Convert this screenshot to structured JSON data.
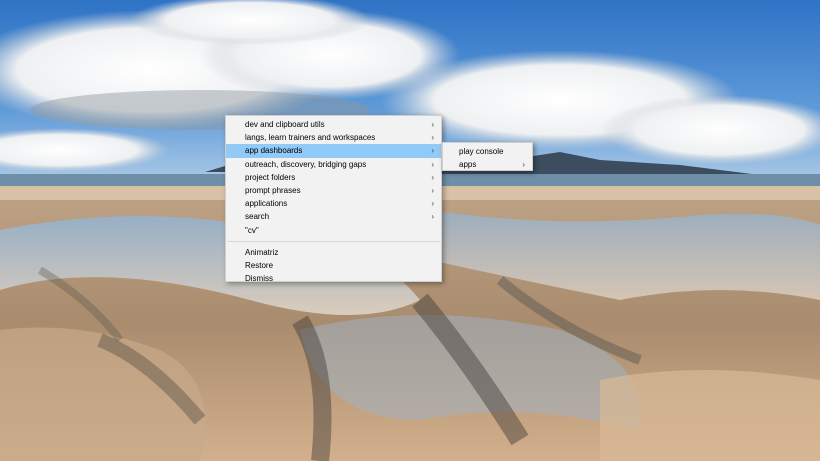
{
  "main_menu": {
    "items": [
      {
        "label": "dev and clipboard utils",
        "has_submenu": true
      },
      {
        "label": "langs, learn trainers and workspaces",
        "has_submenu": true
      },
      {
        "label": "app dashboards",
        "has_submenu": true,
        "highlighted": true
      },
      {
        "label": "outreach, discovery, bridging gaps",
        "has_submenu": true
      },
      {
        "label": "project folders",
        "has_submenu": true
      },
      {
        "label": "prompt phrases",
        "has_submenu": true
      },
      {
        "label": "applications",
        "has_submenu": true
      },
      {
        "label": "search",
        "has_submenu": true
      },
      {
        "label": "\"cv\"",
        "has_submenu": false
      }
    ],
    "bottom_items": [
      {
        "label": "Animatriz"
      },
      {
        "label": "Restore"
      },
      {
        "label": "Dismiss"
      }
    ],
    "arrow_glyph": "›",
    "highlight_color": "#91c9f7"
  },
  "sub_menu": {
    "items": [
      {
        "label": "play console",
        "has_submenu": false
      },
      {
        "label": "apps",
        "has_submenu": true
      }
    ]
  },
  "wallpaper": {
    "sky_color": "#3f82d0",
    "sand_color": "#c9a886",
    "icon": "beach-landscape-image"
  }
}
